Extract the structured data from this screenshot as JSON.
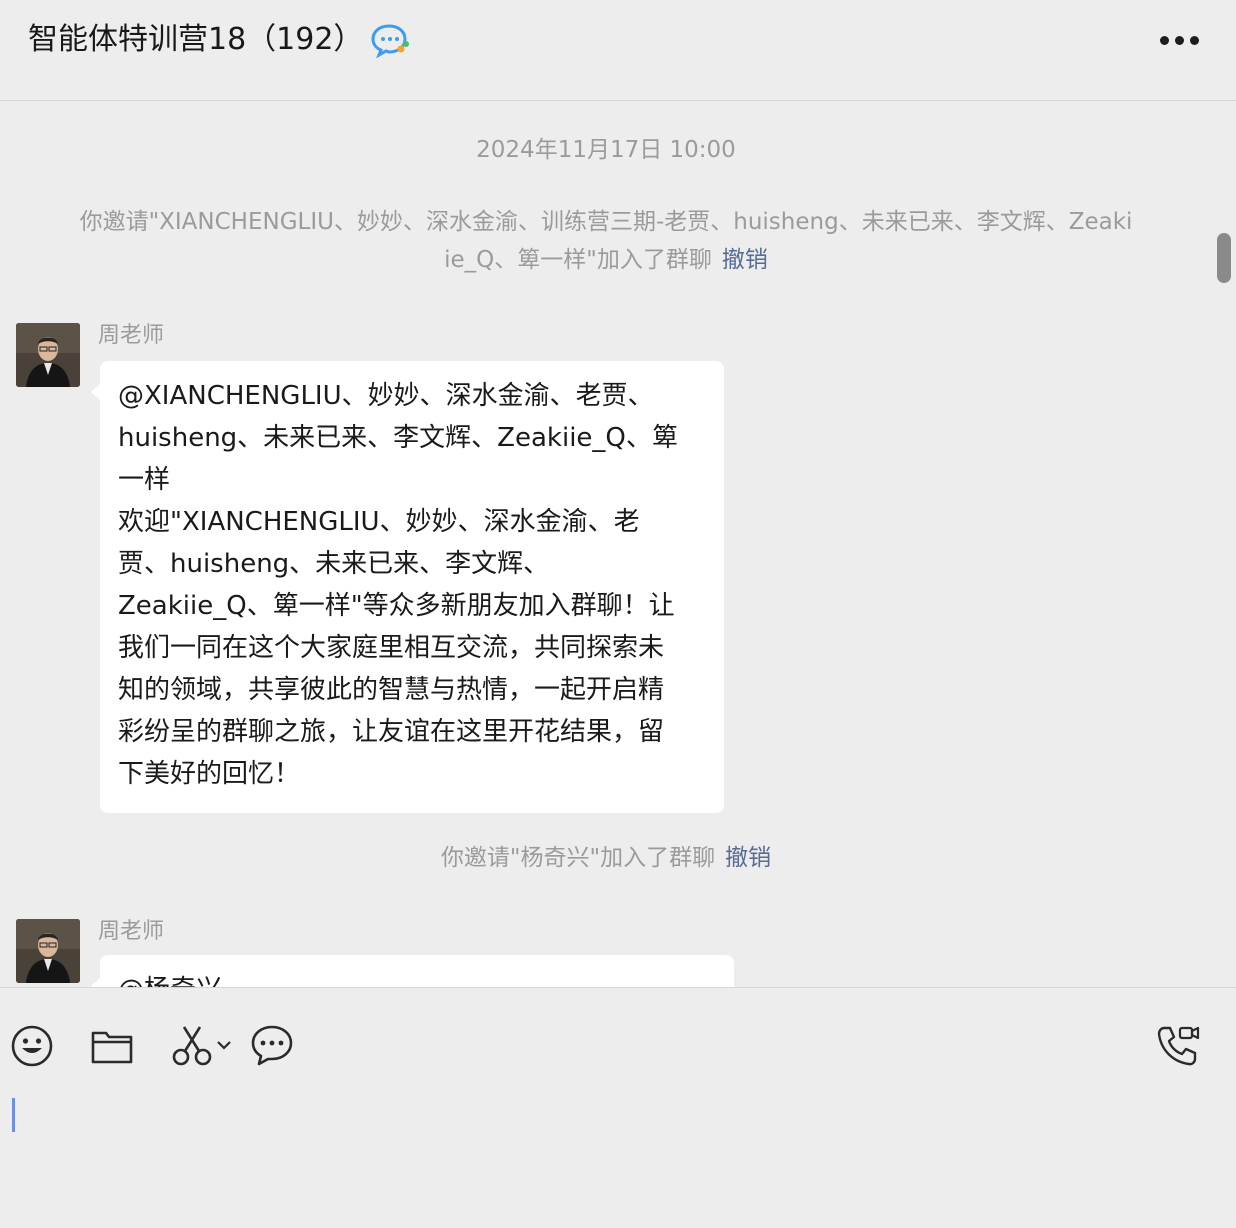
{
  "header": {
    "title": "智能体特训营18（192）",
    "chat_icon": "chat-bubble-icon",
    "more_icon": "more-icon"
  },
  "chat": {
    "timestamp": "2024年11月17日 10:00",
    "system_1": {
      "line1": "你邀请\"XIANCHENGLIU、妙妙、深水金渝、训练营三期-老贾、huisheng、未来已来、李文辉、Zeaki",
      "line2": "ie_Q、箄一样\"加入了群聊",
      "revoke": "撤销"
    },
    "message_1": {
      "sender": "周老师",
      "lines": [
        "@XIANCHENGLIU、妙妙、深水金渝、老贾、",
        "huisheng、未来已来、李文辉、Zeakiie_Q、箄",
        "一样",
        "欢迎\"XIANCHENGLIU、妙妙、深水金渝、老",
        "贾、huisheng、未来已来、李文辉、",
        "Zeakiie_Q、箄一样\"等众多新朋友加入群聊！让",
        "我们一同在这个大家庭里相互交流，共同探索未",
        "知的领域，共享彼此的智慧与热情，一起开启精",
        "彩纷呈的群聊之旅，让友谊在这里开花结果，留",
        "下美好的回忆！"
      ]
    },
    "system_2": {
      "text": "你邀请\"杨奇兴\"加入了群聊",
      "revoke": "撤销"
    },
    "message_2": {
      "sender": "周老师",
      "partial_text": "@杨奇兴"
    }
  },
  "toolbar": {
    "icons": [
      "emoji-icon",
      "folder-icon",
      "scissors-icon",
      "chat-history-icon",
      "voice-video-call-icon"
    ]
  }
}
